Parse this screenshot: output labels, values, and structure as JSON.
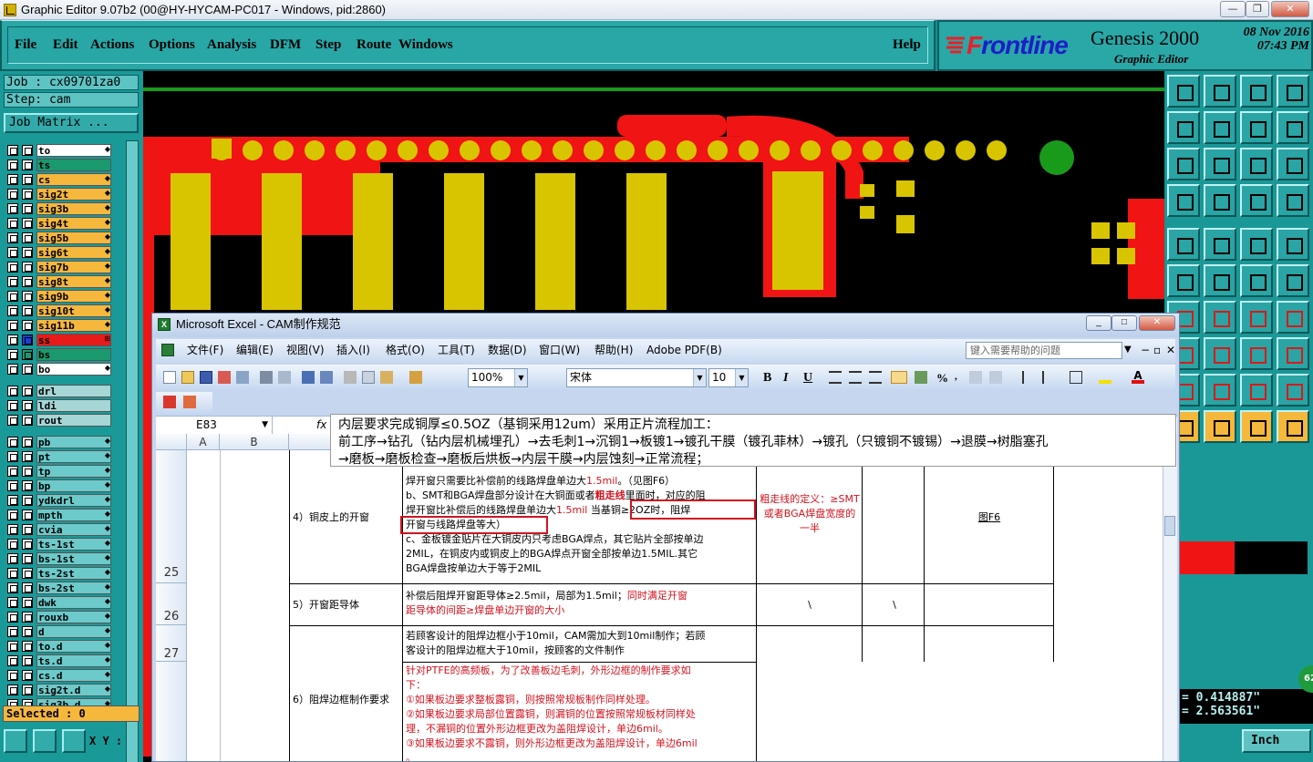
{
  "window": {
    "title": "Graphic Editor 9.07b2 (00@HY-HYCAM-PC017 - Windows, pid:2860)"
  },
  "menu": {
    "items": [
      "File",
      "Edit",
      "Actions",
      "Options",
      "Analysis",
      "DFM",
      "Step",
      "Route",
      "Windows"
    ],
    "help": "Help"
  },
  "logo": {
    "brand_red": "F",
    "brand_blue": "rontline",
    "product": "Genesis 2000",
    "sub": "Graphic Editor",
    "date": "08 Nov 2016",
    "time": "07:43 PM"
  },
  "left": {
    "job": "Job : cx09701za0",
    "step": "Step: cam",
    "job_matrix": "Job Matrix ...",
    "selected": "Selected : 0",
    "xy": "X Y :",
    "layers": [
      {
        "name": "to",
        "color": "#ffffff",
        "arrow": "◆"
      },
      {
        "name": "ts",
        "color": "#1a9a6e",
        "arrow": ""
      },
      {
        "name": "cs",
        "color": "#f5b73c",
        "arrow": "◆"
      },
      {
        "name": "sig2t",
        "color": "#f5b73c",
        "arrow": "◆"
      },
      {
        "name": "sig3b",
        "color": "#f5b73c",
        "arrow": "◆"
      },
      {
        "name": "sig4t",
        "color": "#f5b73c",
        "arrow": "◆"
      },
      {
        "name": "sig5b",
        "color": "#f5b73c",
        "arrow": "◆"
      },
      {
        "name": "sig6t",
        "color": "#f5b73c",
        "arrow": "◆"
      },
      {
        "name": "sig7b",
        "color": "#f5b73c",
        "arrow": "◆"
      },
      {
        "name": "sig8t",
        "color": "#f5b73c",
        "arrow": "◆"
      },
      {
        "name": "sig9b",
        "color": "#f5b73c",
        "arrow": "◆"
      },
      {
        "name": "sig10t",
        "color": "#f5b73c",
        "arrow": "◆"
      },
      {
        "name": "sig11b",
        "color": "#f5b73c",
        "arrow": "◆"
      },
      {
        "name": "ss",
        "color": "#e81a1a",
        "arrow": "⊞"
      },
      {
        "name": "bs",
        "color": "#1a9a6e",
        "arrow": ""
      },
      {
        "name": "bo",
        "color": "#ffffff",
        "arrow": "◆"
      }
    ],
    "drill_layers": [
      "drl",
      "ldi",
      "rout"
    ],
    "other_layers": [
      "pb",
      "pt",
      "tp",
      "bp",
      "ydkdrl",
      "mpth",
      "cvia",
      "ts-1st",
      "bs-1st",
      "ts-2st",
      "bs-2st",
      "dwk",
      "rouxb",
      "d",
      "to.d",
      "ts.d",
      "cs.d",
      "sig2t.d",
      "sig3b.d"
    ]
  },
  "coords": {
    "x": "= 0.414887\"",
    "y": "= 2.563561\"",
    "unit": "Inch",
    "badge": "62"
  },
  "excel": {
    "title": "Microsoft Excel - CAM制作规范",
    "menu": [
      "文件(F)",
      "编辑(E)",
      "视图(V)",
      "插入(I)",
      "格式(O)",
      "工具(T)",
      "数据(D)",
      "窗口(W)",
      "帮助(H)",
      "Adobe PDF(B)"
    ],
    "help_placeholder": "键入需要帮助的问题",
    "zoom": "100%",
    "font": "宋体",
    "size": "10",
    "namebox": "E83",
    "fx": "fx",
    "columns": [
      "A",
      "B",
      "C"
    ],
    "rows": [
      "25",
      "26",
      "27"
    ],
    "comment": [
      "内层要求完成铜厚≤0.5OZ（基铜采用12um）采用正片流程加工：",
      "前工序→钻孔（钻内层机械埋孔）→去毛刺1→沉铜1→板镀1→镀孔干膜（镀孔菲林）→镀孔（只镀铜不镀锡）→退膜→树脂塞孔",
      "→磨板→磨板检查→磨板后烘板→内层干膜→内层蚀刻→正常流程；"
    ],
    "r25": {
      "label": "4）铜皮上的开窗",
      "l1": "焊开窗只需要比补偿前的线路焊盘单边大",
      "l1r": "1.5mil",
      "l1e": "。（见图F6）",
      "l2": "b、SMT和BGA焊盘部分设计在大铜面或者",
      "l2b": "粗走线",
      "l2e": "里面时，对应的阻",
      "l3": "焊开窗比补偿后的线路焊盘单边大",
      "l3r": "1.5mil",
      "l3box": "当基铜≥2OZ时，阻焊",
      "l4": "开窗与线路焊盘等大）",
      "l5": "c、金板镀金贴片在大铜皮内只考虑BGA焊点，其它贴片全部按单边",
      "l6": "2MIL，在铜皮内或铜皮上的BGA焊点开窗全部按单边1.5MIL.其它",
      "l7": "BGA焊盘按单边大于等于2MIL",
      "d": "粗走线的定义：≥SMT或者BGA焊盘宽度的一半",
      "f": "图F6"
    },
    "r26": {
      "label": "5）开窗距导体",
      "t1": "补偿后阻焊开窗距导体≥2.5mil，局部为1.5mil；",
      "t1r": "同时满足开窗",
      "t2r": "距导体的间距≥焊盘单边开窗的大小",
      "d": "\\",
      "e": "\\"
    },
    "r27": {
      "t1": "若顾客设计的阻焊边框小于10mil，CAM需加大到10mil制作；若顾",
      "t2": "客设计的阻焊边框大于10mil，按顾客的文件制作"
    },
    "r28": {
      "label": "6）阻焊边框制作要求",
      "t1": "针对PTFE的高频板，为了改善板边毛刺，外形边框的制作要求如",
      "t2": "下：",
      "t3": "①如果板边要求整板露铜，则按照常规板制作同样处理。",
      "t4": "②如果板边要求局部位置露铜，则漏铜的位置按照常规板材同样处",
      "t5": "理，不漏铜的位置外形边框更改为盖阻焊设计，单边6mil。",
      "t6": "③如果板边要求不露铜，则外形边框更改为盖阻焊设计，单边6mil",
      "t7": "。"
    }
  }
}
